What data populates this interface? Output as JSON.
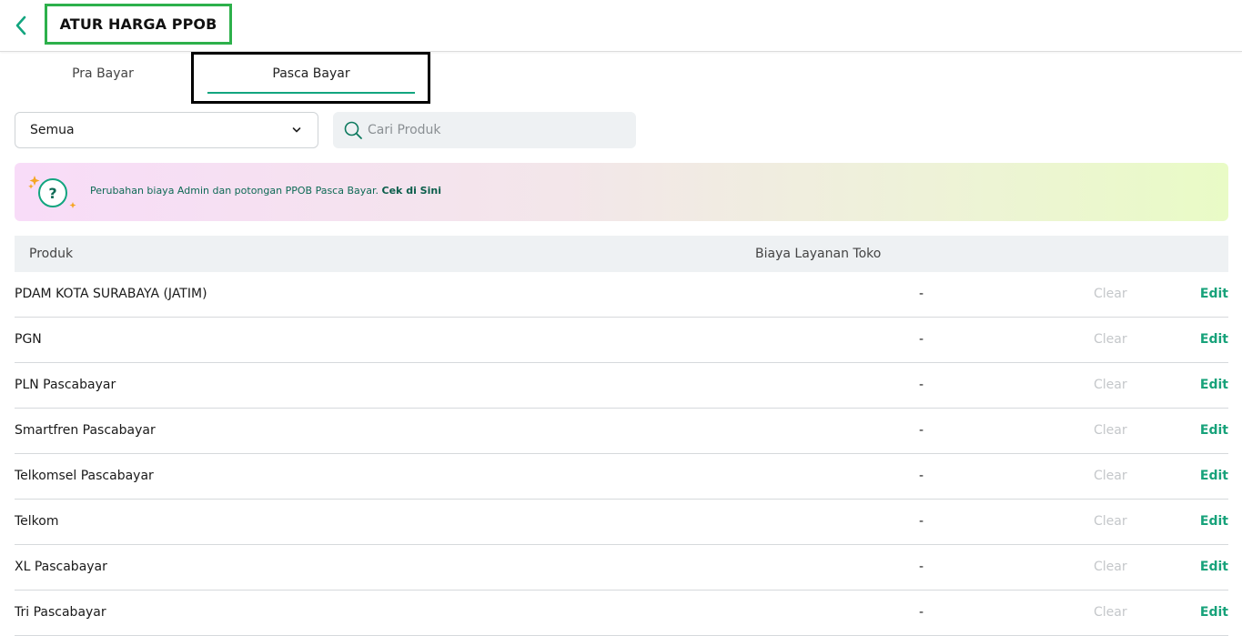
{
  "header": {
    "title": "ATUR HARGA PPOB",
    "back_icon": "chevron-left-icon",
    "accent": "#12a57f"
  },
  "tabs": [
    {
      "label": "Pra Bayar",
      "active": false
    },
    {
      "label": "Pasca Bayar",
      "active": true
    }
  ],
  "filter": {
    "selected": "Semua",
    "icon": "chevron-down-icon"
  },
  "search": {
    "placeholder": "Cari Produk",
    "value": "",
    "icon": "search-icon"
  },
  "banner": {
    "text": "Perubahan biaya Admin dan potongan PPOB Pasca Bayar.",
    "link": "Cek di Sini",
    "icon": "question-sparkle-icon"
  },
  "table": {
    "headers": {
      "produk": "Produk",
      "biaya": "Biaya Layanan Toko"
    },
    "clear_label": "Clear",
    "edit_label": "Edit",
    "rows": [
      {
        "name": "PDAM KOTA SURABAYA (JATIM)",
        "fee": "-"
      },
      {
        "name": "PGN",
        "fee": "-"
      },
      {
        "name": "PLN Pascabayar",
        "fee": "-"
      },
      {
        "name": "Smartfren Pascabayar",
        "fee": "-"
      },
      {
        "name": "Telkomsel Pascabayar",
        "fee": "-"
      },
      {
        "name": "Telkom",
        "fee": "-"
      },
      {
        "name": "XL Pascabayar",
        "fee": "-"
      },
      {
        "name": "Tri Pascabayar",
        "fee": "-"
      }
    ]
  }
}
